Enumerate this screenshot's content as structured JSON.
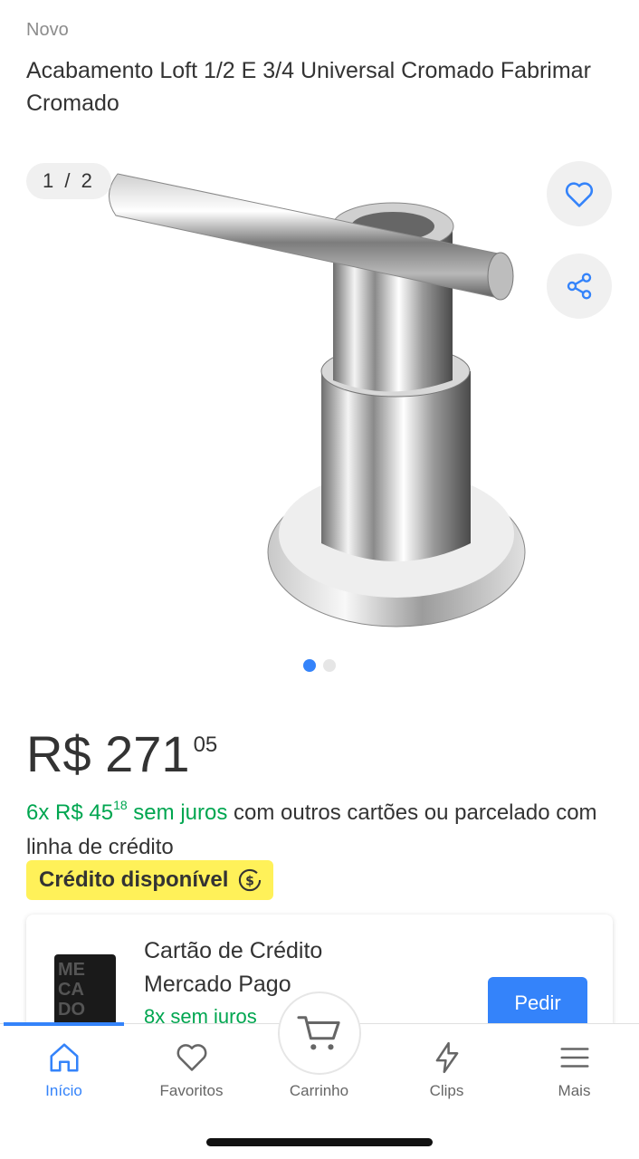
{
  "product": {
    "condition": "Novo",
    "title": "Acabamento Loft 1/2 E 3/4 Universal Cromado Fabrimar Cromado",
    "gallery_counter": "1 / 2",
    "gallery_current_page": 1,
    "gallery_total_pages": 2
  },
  "price": {
    "main": "R$ 271",
    "cents": "05"
  },
  "installments": {
    "count_prefix": "6x R$ 45",
    "cents": "18",
    "no_interest": " sem juros",
    "rest": " com outros cartões ou parcelado com linha de crédito"
  },
  "credit_badge": {
    "label": "Crédito disponível"
  },
  "card_offer": {
    "title": "Cartão de Crédito Mercado Pago",
    "subtitle": "8x sem juros",
    "card_art_text": "ME CA DO PAGO",
    "button_label": "Pedir"
  },
  "tabbar": {
    "items": [
      {
        "label": "Início",
        "icon": "home-icon",
        "active": true
      },
      {
        "label": "Favoritos",
        "icon": "heart-icon",
        "active": false
      },
      {
        "label": "Carrinho",
        "icon": "cart-icon",
        "active": false
      },
      {
        "label": "Clips",
        "icon": "lightning-icon",
        "active": false
      },
      {
        "label": "Mais",
        "icon": "menu-icon",
        "active": false
      }
    ]
  },
  "colors": {
    "accent": "#3483fa",
    "green": "#00a650",
    "badge_yellow": "#fff159"
  }
}
